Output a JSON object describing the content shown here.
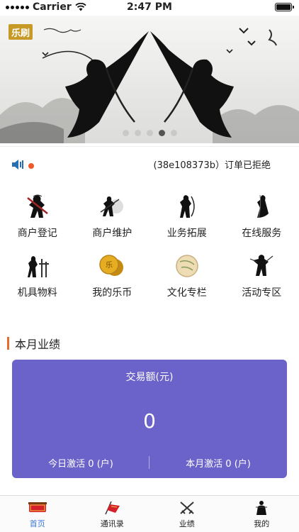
{
  "status_bar": {
    "carrier": "Carrier",
    "time": "2:47 PM"
  },
  "banner": {
    "logo_text": "乐刷",
    "slides": 5,
    "active_slide": 4
  },
  "notice": {
    "text": "(38e108373b）订单已拒绝",
    "accent": "#f05a28"
  },
  "grid": {
    "items": [
      {
        "label": "商户登记",
        "icon": "warrior-icon"
      },
      {
        "label": "商户维护",
        "icon": "swordsman-icon"
      },
      {
        "label": "业务拓展",
        "icon": "archer-icon"
      },
      {
        "label": "在线服务",
        "icon": "robed-figure-icon"
      },
      {
        "label": "机具物料",
        "icon": "weapons-icon"
      },
      {
        "label": "我的乐币",
        "icon": "coins-icon"
      },
      {
        "label": "文化专栏",
        "icon": "scroll-icon"
      },
      {
        "label": "活动专区",
        "icon": "dancer-icon"
      }
    ]
  },
  "performance": {
    "title": "本月业绩",
    "card_title": "交易额(元)",
    "amount": "0",
    "today": "今日激活 0 (户)",
    "month": "本月激活 0 (户)",
    "card_color": "#6b63c9"
  },
  "tabs": [
    {
      "label": "首页",
      "icon": "home-badge-icon",
      "active": true
    },
    {
      "label": "通讯录",
      "icon": "flag-icon",
      "active": false
    },
    {
      "label": "业绩",
      "icon": "crossed-swords-icon",
      "active": false
    },
    {
      "label": "我的",
      "icon": "person-icon",
      "active": false
    }
  ]
}
